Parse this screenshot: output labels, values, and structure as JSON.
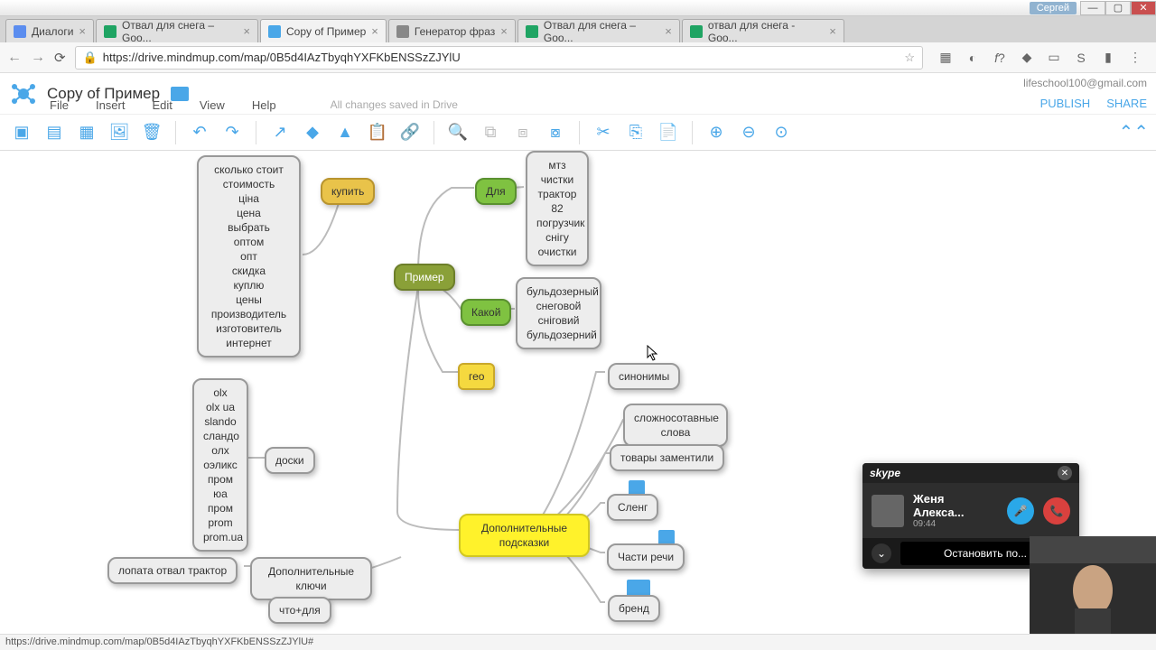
{
  "window": {
    "user": "Сергей"
  },
  "tabs": [
    {
      "label": "Диалоги",
      "fav": "#5b8def"
    },
    {
      "label": "Отвал для снега – Goo...",
      "fav": "#1fa463"
    },
    {
      "label": "Copy of Пример",
      "fav": "#4aa7e8",
      "active": true
    },
    {
      "label": "Генератор фраз",
      "fav": "#888"
    },
    {
      "label": "Отвал для снега – Goo...",
      "fav": "#1fa463"
    },
    {
      "label": "отвал для снега - Goo...",
      "fav": "#1fa463"
    }
  ],
  "url": "https://drive.mindmup.com/map/0B5d4IAzTbyqhYXFKbENSSzZJYlU",
  "header": {
    "title": "Copy of Пример",
    "email": "lifeschool100@gmail.com",
    "publish": "PUBLISH",
    "share": "SHARE",
    "menu": [
      "File",
      "Insert",
      "Edit",
      "View",
      "Help"
    ],
    "status": "All changes saved in Drive"
  },
  "nodes": {
    "col1": "сколько стоит\nстоимость\nціна\nцена\nвыбрать\nоптом\nопт\nскидка\nкуплю\nцены\nпроизводитель\nизготовитель\nинтернет",
    "kupit": "купить",
    "primer": "Пример",
    "dlya": "Для",
    "col2": "мтз\nчистки\nтрактор\n82\nпогрузчик\nснігу\nочистки",
    "kakoi": "Какой",
    "col3": "бульдозерный\nснеговой\nсніговий\nбульдозерний",
    "geo": "гео",
    "sinonimy": "синонимы",
    "slozhno": "сложносотавные слова",
    "tovary": "товары заментили",
    "sleng": "Сленг",
    "chasti": "Части речи",
    "brand": "бренд",
    "dop_podskazki": "Дополнительные подсказки",
    "boards_list": "olx\nolx ua\nslando\nсландо\nолх\nоэликс\nпром юа\nпром\nprom\nprom.ua",
    "doski": "доски",
    "lopata": "лопата отвал трактор",
    "dop_kluchi": "Дополнительные ключи",
    "chto_dlya": "что+для"
  },
  "skype": {
    "brand": "skype",
    "name": "Женя Алекса...",
    "time": "09:44",
    "stop": "Остановить по..."
  },
  "statusbar": "https://drive.mindmup.com/map/0B5d4IAzTbyqhYXFKbENSSzZJYlU#"
}
